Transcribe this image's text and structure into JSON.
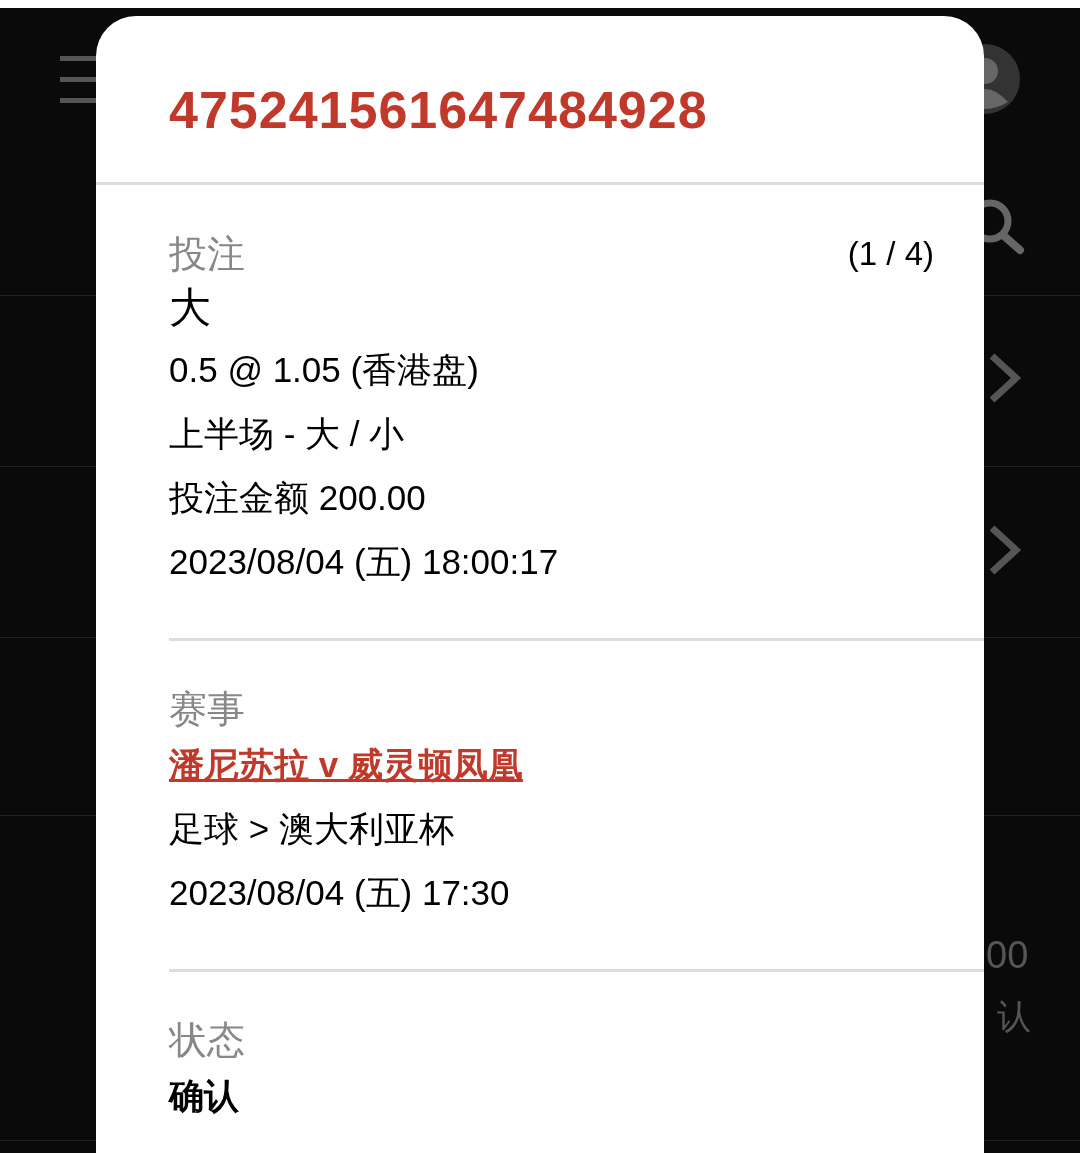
{
  "background": {
    "fragments": [
      "00",
      "认"
    ]
  },
  "modal": {
    "bet_id": "475241561647484928",
    "sections": [
      {
        "heading": "投注",
        "counter": "(1 / 4)",
        "lines": [
          {
            "kind": "big",
            "text": "大"
          },
          {
            "kind": "text",
            "text": "0.5 @ 1.05 (香港盘)"
          },
          {
            "kind": "text",
            "text": "上半场 - 大 / 小"
          },
          {
            "kind": "text",
            "text": "投注金额 200.00"
          },
          {
            "kind": "text",
            "text": "2023/08/04 (五) 18:00:17"
          }
        ]
      },
      {
        "heading": "赛事",
        "lines": [
          {
            "kind": "link",
            "text": "潘尼苏拉 v 威灵顿凤凰"
          },
          {
            "kind": "text",
            "text": "足球 > 澳大利亚杯"
          },
          {
            "kind": "text",
            "text": "2023/08/04 (五) 17:30"
          }
        ]
      },
      {
        "heading": "状态",
        "lines": [
          {
            "kind": "strong",
            "text": "确认"
          }
        ]
      }
    ]
  }
}
